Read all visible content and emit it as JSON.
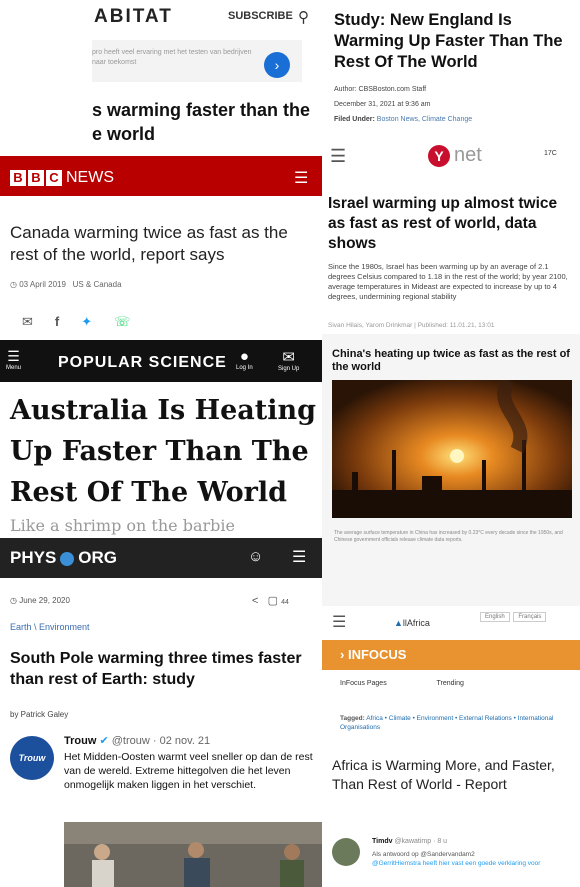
{
  "habitat": {
    "logo": "ABITAT",
    "subscribe": "SUBSCRIBE",
    "ad_text": "pro heeft veel ervaring met het testen van bedrijven naar toekomst",
    "headline": "s warming faster than the e world"
  },
  "cbs": {
    "headline": "Study: New England Is Warming Up Faster Than The Rest Of The World",
    "author": "Author: CBSBoston.com Staff",
    "date": "December 31, 2021 at 9:36 am",
    "filed_label": "Filed Under:",
    "filed_tags": "Boston News, Climate Change"
  },
  "bbc": {
    "blocks": [
      "B",
      "B",
      "C"
    ],
    "news": "NEWS",
    "headline": "Canada warming twice as fast as the rest of the world, report says",
    "date": "03 April 2019",
    "section": "US & Canada"
  },
  "ynet": {
    "logo_y": "Y",
    "logo_net": "net",
    "weather": "17C",
    "headline": "Israel warming up almost twice as fast as rest of world, data shows",
    "body": "Since the 1980s, Israel has been warming up by an average of 2.1 degrees Celsius compared to 1.18 in the rest of the world; by year 2100, average temperatures in Mideast are expected to increase by up to 4 degrees, undermining regional stability",
    "byline": "Sivan Hilais, Yarom Drinkmar | Published: 11.01.21, 13:01"
  },
  "popsci": {
    "menu_label": "Menu",
    "logo": "POPULAR SCIENCE",
    "login_label": "Log In",
    "signup_label": "Sign Up",
    "headline": "Australia Is Heating Up Faster Than The Rest Of The World",
    "dek": "Like a shrimp on the barbie"
  },
  "china": {
    "headline": "China's heating up twice as fast as the rest of the world",
    "caption": "The average surface temperature in China has increased by 0.23°C every decade since the 1950s, and Chinese government officials release climate data reports."
  },
  "phys": {
    "logo_left": "PHYS",
    "logo_right": "ORG",
    "date": "June 29, 2020",
    "comments": "44",
    "category": "Earth \\ Environment",
    "headline": "South Pole warming three times faster than rest of Earth: study",
    "byline": "by Patrick Galey"
  },
  "trouw": {
    "avatar_text": "Trouw",
    "name": "Trouw",
    "handle": "@trouw",
    "date": "02 nov. 21",
    "text": "Het Midden-Oosten warmt veel sneller op dan de rest van de wereld. Extreme hittegolven die het leven onmogelijk maken liggen in het verschiet."
  },
  "africa": {
    "logo": "llAfrica",
    "lang_en": "English",
    "lang_fr": "Français",
    "infocus": "INFOCUS",
    "tab1": "InFocus Pages",
    "tab2": "Trending",
    "tags_label": "Tagged:",
    "tags": "Africa • Climate • Environment • External Relations • International Organisations",
    "headline": "Africa is Warming More, and Faster, Than Rest of World - Report",
    "tweet_name": "Timdv",
    "tweet_handle": "@kawatimp · 8 u",
    "tweet_reply": "Als antwoord op @Sandervandam2",
    "tweet_text": "@GerritHiemstra heeft hier vast een goede verklaring voor"
  },
  "colors": {
    "bbc_red": "#b80000",
    "ynet_red": "#c8102e",
    "infocus_orange": "#e8932f",
    "phys_blue": "#3a8fd6"
  }
}
